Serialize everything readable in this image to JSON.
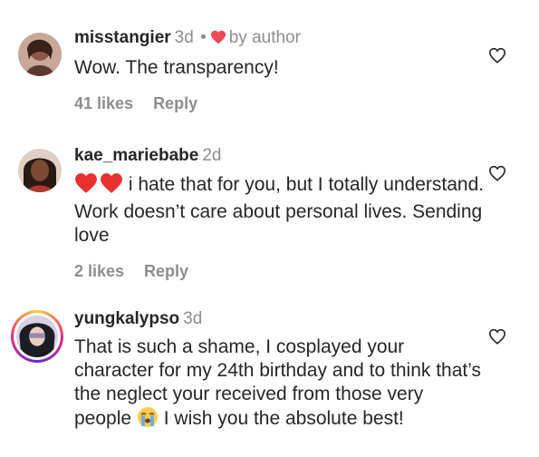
{
  "comments": [
    {
      "username": "misstangier",
      "time": "3d",
      "dot": "•",
      "author_badge": "by author",
      "text": "Wow. The transparency!",
      "likes": "41 likes",
      "reply": "Reply"
    },
    {
      "username": "kae_mariebabe",
      "time": "2d",
      "text_after_hearts": "i hate that for you, but I totally",
      "text_rest": "understand. Work doesn’t care about personal lives. Sending love",
      "likes": "2 likes",
      "reply": "Reply"
    },
    {
      "username": "yungkalypso",
      "time": "3d",
      "text_before_emoji": "That is such a shame, I cosplayed your character for my 24th birthday and to think that’s the neglect your received from those very people",
      "text_after_emoji": "I wish you the absolute best!"
    }
  ],
  "colors": {
    "text": "#262626",
    "muted": "#8e8e8e",
    "heart": "#ed4956"
  },
  "icons": {
    "like": "heart-outline-icon",
    "author_like": "heart-filled-icon",
    "inline_heart": "red-heart-emoji",
    "crying_emoji": "loudly-crying-face-emoji"
  }
}
